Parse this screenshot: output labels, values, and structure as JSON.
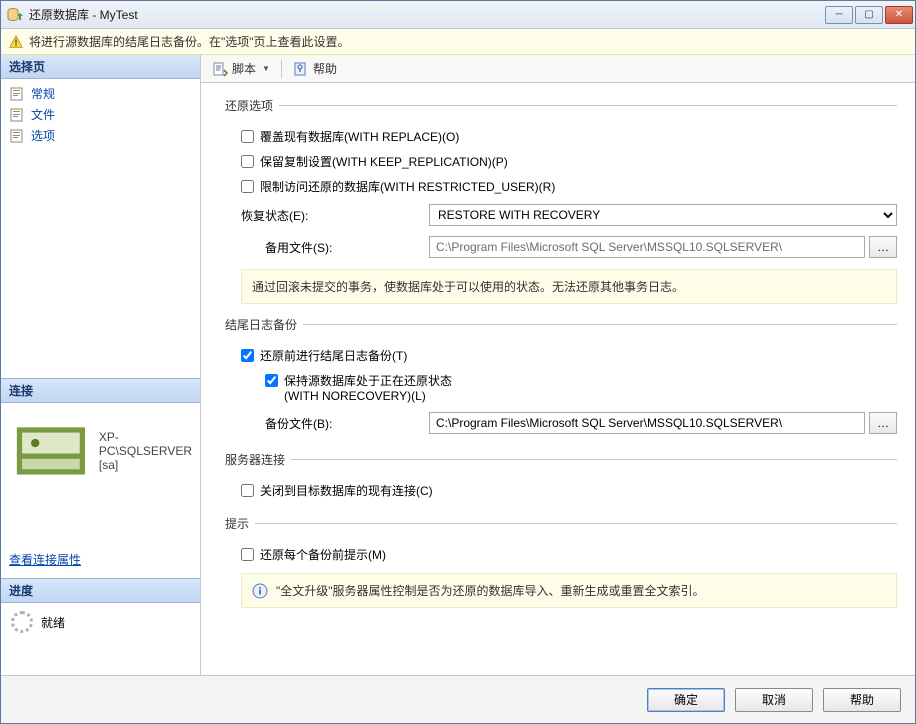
{
  "window": {
    "title": "还原数据库 - MyTest"
  },
  "warning": {
    "text": "将进行源数据库的结尾日志备份。在\"选项\"页上查看此设置。"
  },
  "left": {
    "select_page": "选择页",
    "nav": {
      "general": "常规",
      "files": "文件",
      "options": "选项"
    },
    "connection_hd": "连接",
    "server": "XP-PC\\SQLSERVER [sa]",
    "view_conn": "查看连接属性",
    "progress_hd": "进度",
    "progress_status": "就绪"
  },
  "toolbar": {
    "script": "脚本",
    "help": "帮助"
  },
  "restore_options": {
    "legend": "还原选项",
    "replace": "覆盖现有数据库(WITH REPLACE)(O)",
    "keep_repl": "保留复制设置(WITH KEEP_REPLICATION)(P)",
    "restricted": "限制访问还原的数据库(WITH RESTRICTED_USER)(R)",
    "recovery_lbl": "恢复状态(E):",
    "recovery_val": "RESTORE WITH RECOVERY",
    "standby_lbl": "备用文件(S):",
    "standby_val": "C:\\Program Files\\Microsoft SQL Server\\MSSQL10.SQLSERVER\\",
    "desc": "通过回滚未提交的事务，使数据库处于可以使用的状态。无法还原其他事务日志。"
  },
  "tail_log": {
    "legend": "结尾日志备份",
    "take": "还原前进行结尾日志备份(T)",
    "keep_src_line1": "保持源数据库处于正在还原状态",
    "keep_src_line2": "(WITH NORECOVERY)(L)",
    "backup_lbl": "备份文件(B):",
    "backup_val": "C:\\Program Files\\Microsoft SQL Server\\MSSQL10.SQLSERVER\\"
  },
  "server_conn": {
    "legend": "服务器连接",
    "close_existing": "关闭到目标数据库的现有连接(C)"
  },
  "prompt": {
    "legend": "提示",
    "before_each": "还原每个备份前提示(M)",
    "fulltext": "\"全文升级\"服务器属性控制是否为还原的数据库导入、重新生成或重置全文索引。"
  },
  "footer": {
    "ok": "确定",
    "cancel": "取消",
    "help": "帮助"
  },
  "colors": {
    "accent": "#0645ad"
  }
}
